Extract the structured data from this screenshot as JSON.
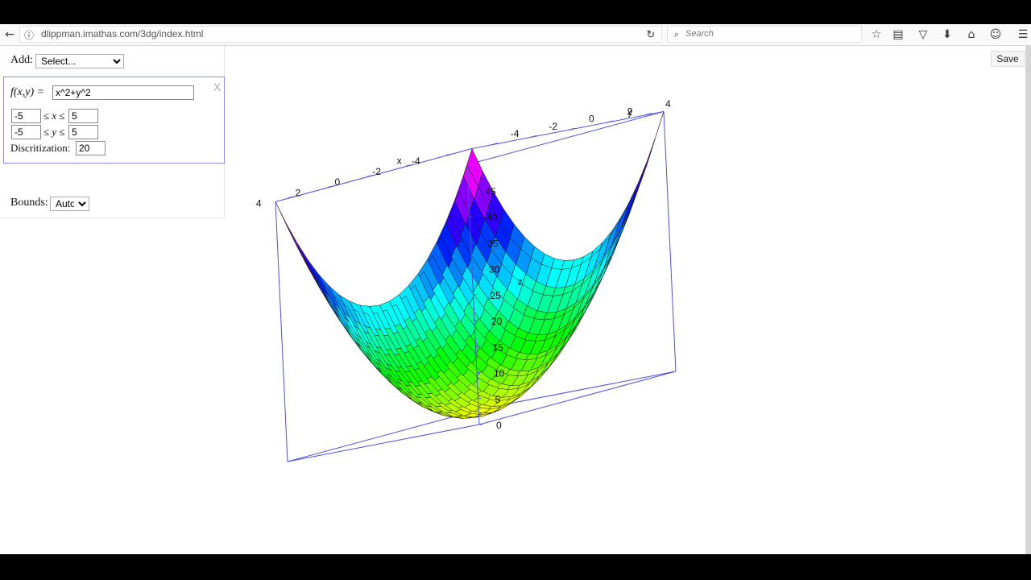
{
  "browser": {
    "url": "dlippman.imathas.com/3dg/index.html",
    "search_placeholder": "Search"
  },
  "panel": {
    "add_label": "Add:",
    "add_select_value": "Select...",
    "function_label": "f(x,y) =",
    "function_value": "x^2+y^2",
    "close_label": "X",
    "x_min": "-5",
    "x_max": "5",
    "x_label": "≤ x ≤",
    "y_min": "-5",
    "y_max": "5",
    "y_label": "≤ y ≤",
    "discretization_label": "Discritization:",
    "discretization_value": "20",
    "bounds_label": "Bounds:",
    "bounds_value": "Auto"
  },
  "save_label": "Save",
  "colors": {
    "box": "#5050d8",
    "panel_border": "#8d8df0"
  },
  "chart_data": {
    "type": "surface",
    "function": "x^2+y^2",
    "xlim": [
      -5,
      5
    ],
    "ylim": [
      -5,
      5
    ],
    "zlim": [
      0,
      50
    ],
    "discretization": 20,
    "xlabel": "x",
    "ylabel": "y",
    "zlabel": "z",
    "x_ticks": [
      "4",
      "2",
      "0",
      "-2",
      "-4"
    ],
    "y_ticks": [
      "-4",
      "-2",
      "0",
      "2",
      "4"
    ],
    "z_ticks": [
      "0",
      "5",
      "10",
      "15",
      "20",
      "25",
      "30",
      "35",
      "40",
      "45"
    ]
  }
}
